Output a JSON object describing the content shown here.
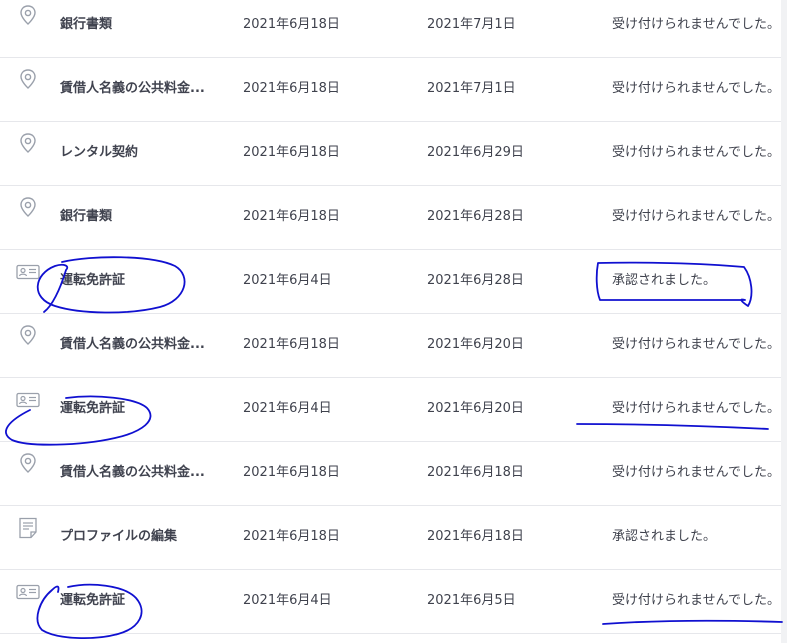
{
  "rows": [
    {
      "icon": "location-pin-icon",
      "type": "銀行書類",
      "date1": "2021年6月18日",
      "date2": "2021年7月1日",
      "status": "受け付けられませんでした。"
    },
    {
      "icon": "location-pin-icon",
      "type": "賃借人名義の公共料金...",
      "date1": "2021年6月18日",
      "date2": "2021年7月1日",
      "status": "受け付けられませんでした。"
    },
    {
      "icon": "location-pin-icon",
      "type": "レンタル契約",
      "date1": "2021年6月18日",
      "date2": "2021年6月29日",
      "status": "受け付けられませんでした。"
    },
    {
      "icon": "location-pin-icon",
      "type": "銀行書類",
      "date1": "2021年6月18日",
      "date2": "2021年6月28日",
      "status": "受け付けられませんでした。"
    },
    {
      "icon": "id-card-icon",
      "type": "運転免許証",
      "date1": "2021年6月4日",
      "date2": "2021年6月28日",
      "status": "承認されました。"
    },
    {
      "icon": "location-pin-icon",
      "type": "賃借人名義の公共料金...",
      "date1": "2021年6月18日",
      "date2": "2021年6月20日",
      "status": "受け付けられませんでした。"
    },
    {
      "icon": "id-card-icon",
      "type": "運転免許証",
      "date1": "2021年6月4日",
      "date2": "2021年6月20日",
      "status": "受け付けられませんでした。"
    },
    {
      "icon": "location-pin-icon",
      "type": "賃借人名義の公共料金...",
      "date1": "2021年6月18日",
      "date2": "2021年6月18日",
      "status": "受け付けられませんでした。"
    },
    {
      "icon": "document-icon",
      "type": "プロファイルの編集",
      "date1": "2021年6月18日",
      "date2": "2021年6月18日",
      "status": "承認されました。"
    },
    {
      "icon": "id-card-icon",
      "type": "運転免許証",
      "date1": "2021年6月4日",
      "date2": "2021年6月5日",
      "status": "受け付けられませんでした。"
    }
  ],
  "colors": {
    "annotation_ink": "#1010d0",
    "icon_gray": "#9aa0ab",
    "divider": "#e6e7eb"
  }
}
